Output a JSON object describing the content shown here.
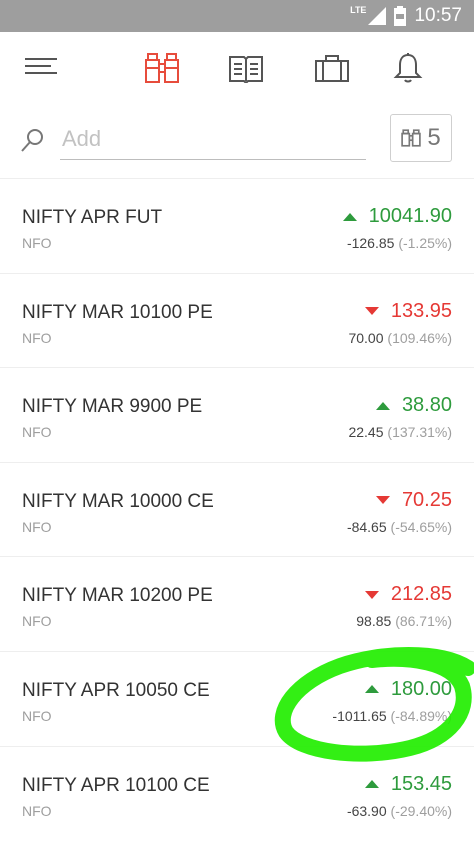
{
  "status": {
    "network": "LTE",
    "time": "10:57"
  },
  "search": {
    "placeholder": "Add"
  },
  "marketwatch": {
    "number": "5"
  },
  "instruments": [
    {
      "symbol": "NIFTY APR FUT",
      "exchange": "NFO",
      "ltp": "10041.90",
      "direction": "up",
      "change": "-126.85",
      "pct": "(-1.25%)"
    },
    {
      "symbol": "NIFTY MAR 10100 PE",
      "exchange": "NFO",
      "ltp": "133.95",
      "direction": "down",
      "change": "70.00",
      "pct": "(109.46%)"
    },
    {
      "symbol": "NIFTY MAR 9900 PE",
      "exchange": "NFO",
      "ltp": "38.80",
      "direction": "up",
      "change": "22.45",
      "pct": "(137.31%)"
    },
    {
      "symbol": "NIFTY MAR 10000 CE",
      "exchange": "NFO",
      "ltp": "70.25",
      "direction": "down",
      "change": "-84.65",
      "pct": "(-54.65%)"
    },
    {
      "symbol": "NIFTY MAR 10200 PE",
      "exchange": "NFO",
      "ltp": "212.85",
      "direction": "down",
      "change": "98.85",
      "pct": "(86.71%)"
    },
    {
      "symbol": "NIFTY APR 10050 CE",
      "exchange": "NFO",
      "ltp": "180.00",
      "direction": "up",
      "change": "-1011.65",
      "pct": "(-84.89%)"
    },
    {
      "symbol": "NIFTY APR 10100 CE",
      "exchange": "NFO",
      "ltp": "153.45",
      "direction": "up",
      "change": "-63.90",
      "pct": "(-29.40%)"
    }
  ],
  "colors": {
    "up": "#2e9b3d",
    "down": "#e53935",
    "brand": "#e74c3c",
    "annotation": "#22ee00"
  },
  "icons": [
    "menu-icon",
    "binoculars-icon",
    "book-icon",
    "briefcase-icon",
    "bell-icon",
    "search-icon",
    "signal-icon",
    "battery-icon"
  ]
}
